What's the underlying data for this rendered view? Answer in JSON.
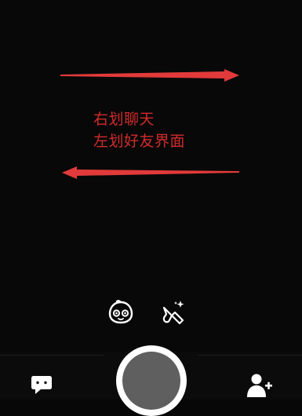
{
  "hint": {
    "line1": "右划聊天",
    "line2": "左划好友界面"
  },
  "colors": {
    "background": "#080808",
    "annotation_red": "#e23a3a",
    "shutter_ring": "#ffffff",
    "shutter_fill": "#5f5f5f"
  },
  "icons": {
    "lens": "lens-face-icon",
    "beauty": "beauty-brush-icon",
    "chat": "chat-icon",
    "add_friend": "add-friend-icon"
  }
}
